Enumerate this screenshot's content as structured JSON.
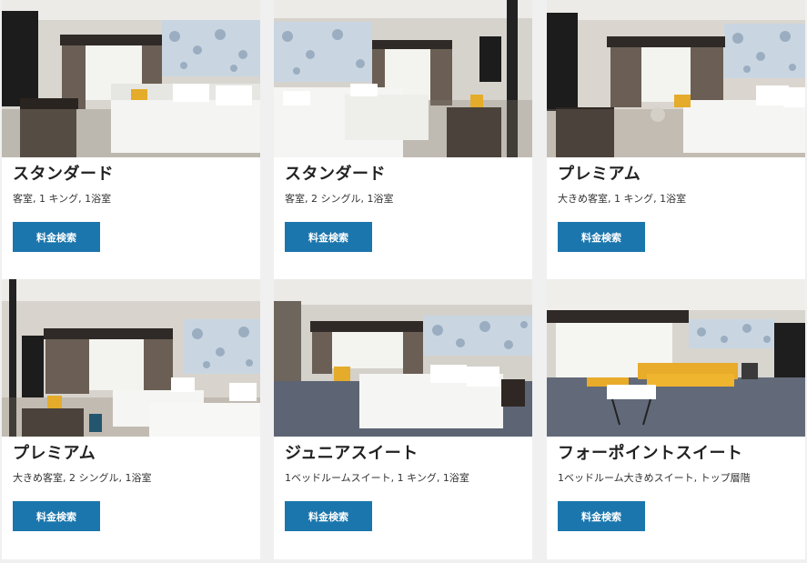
{
  "brand": {
    "button_color": "#1b76ad"
  },
  "rooms": [
    {
      "title": "スタンダード",
      "description": "客室, 1 キング, 1浴室",
      "button_label": "料金検索",
      "photo": "room-photo-standard-king"
    },
    {
      "title": "スタンダード",
      "description": "客室, 2 シングル, 1浴室",
      "button_label": "料金検索",
      "photo": "room-photo-standard-twin"
    },
    {
      "title": "プレミアム",
      "description": "大きめ客室, 1 キング, 1浴室",
      "button_label": "料金検索",
      "photo": "room-photo-premium-king"
    },
    {
      "title": "プレミアム",
      "description": "大きめ客室, 2 シングル, 1浴室",
      "button_label": "料金検索",
      "photo": "room-photo-premium-twin"
    },
    {
      "title": "ジュニアスイート",
      "description": "1ベッドルームスイート, 1 キング, 1浴室",
      "button_label": "料金検索",
      "photo": "room-photo-junior-suite"
    },
    {
      "title": "フォーポイントスイート",
      "description": "1ベッドルーム大きめスイート, トップ層階",
      "button_label": "料金検索",
      "photo": "room-photo-four-points-suite"
    }
  ]
}
